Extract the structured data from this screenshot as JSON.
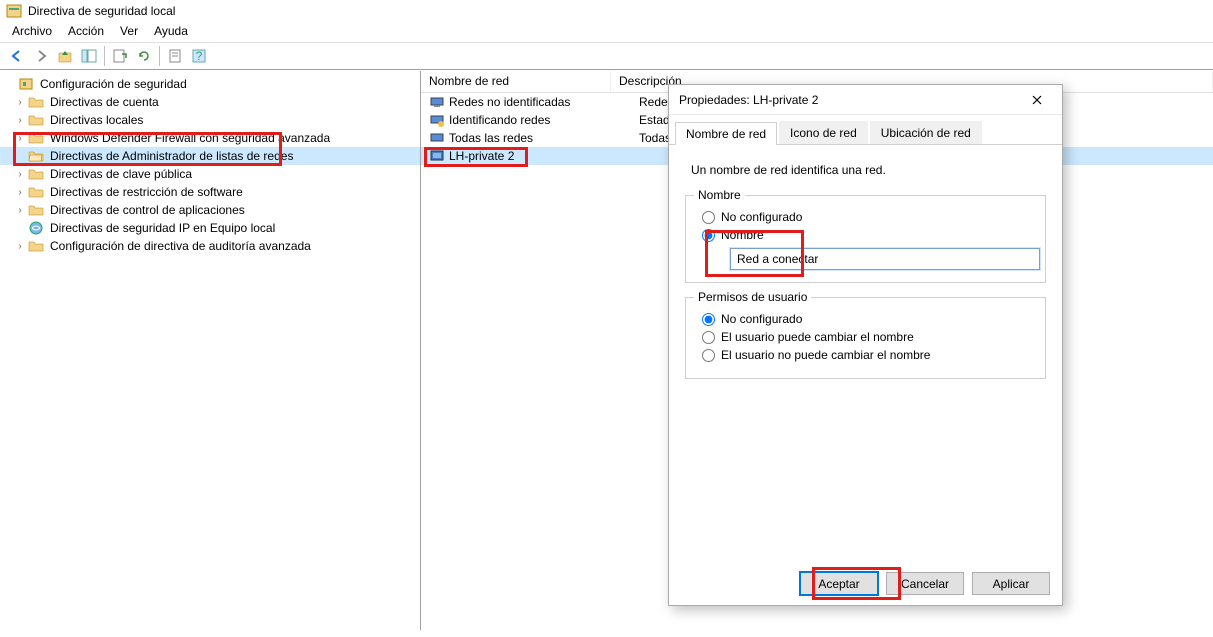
{
  "app": {
    "title": "Directiva de seguridad local"
  },
  "menu": {
    "file": "Archivo",
    "action": "Acción",
    "view": "Ver",
    "help": "Ayuda"
  },
  "tree": {
    "root": "Configuración de seguridad",
    "items": [
      "Directivas de cuenta",
      "Directivas locales",
      "Windows Defender Firewall con seguridad avanzada",
      "Directivas de Administrador de listas de redes",
      "Directivas de clave pública",
      "Directivas de restricción de software",
      "Directivas de control de aplicaciones",
      "Directivas de seguridad IP en Equipo local",
      "Configuración de directiva de auditoría avanzada"
    ]
  },
  "list": {
    "headers": {
      "name": "Nombre de red",
      "desc": "Descripción"
    },
    "rows": [
      {
        "name": "Redes no identificadas",
        "desc": "Redes que no pueden ser identificadas debido a un problema de red o l..."
      },
      {
        "name": "Identificando redes",
        "desc": "Estado temporal de las redes que están en proceso de ser identificadas."
      },
      {
        "name": "Todas las redes",
        "desc": "Todas las redes a las que se conecta un usuario."
      },
      {
        "name": "LH-private  2",
        "desc": ""
      }
    ]
  },
  "dialog": {
    "title": "Propiedades: LH-private  2",
    "tabs": {
      "t1": "Nombre de red",
      "t2": "Icono de red",
      "t3": "Ubicación de red"
    },
    "hint": "Un nombre de red identifica una red.",
    "group_name": {
      "legend": "Nombre",
      "opt_notconf": "No configurado",
      "opt_name": "Nombre",
      "input_value": "Red a conectar"
    },
    "group_perm": {
      "legend": "Permisos de usuario",
      "opt_notconf": "No configurado",
      "opt_can": "El usuario puede cambiar el nombre",
      "opt_cannot": "El usuario no puede cambiar el nombre"
    },
    "buttons": {
      "ok": "Aceptar",
      "cancel": "Cancelar",
      "apply": "Aplicar"
    }
  }
}
